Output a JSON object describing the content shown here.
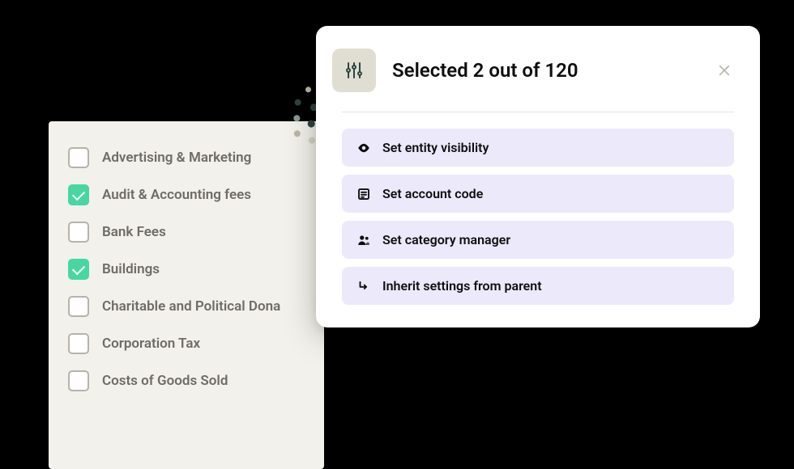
{
  "list": {
    "items": [
      {
        "label": "Advertising & Marketing",
        "checked": false
      },
      {
        "label": "Audit & Accounting fees",
        "checked": true
      },
      {
        "label": "Bank Fees",
        "checked": false
      },
      {
        "label": "Buildings",
        "checked": true
      },
      {
        "label": "Charitable and Political Dona",
        "checked": false
      },
      {
        "label": "Corporation Tax",
        "checked": false
      },
      {
        "label": "Costs of Goods Sold",
        "checked": false
      }
    ]
  },
  "modal": {
    "title": "Selected 2 out of 120",
    "actions": [
      {
        "label": "Set entity visibility",
        "icon": "eye"
      },
      {
        "label": "Set account code",
        "icon": "list"
      },
      {
        "label": "Set category manager",
        "icon": "people"
      },
      {
        "label": "Inherit settings from parent",
        "icon": "return"
      }
    ]
  }
}
